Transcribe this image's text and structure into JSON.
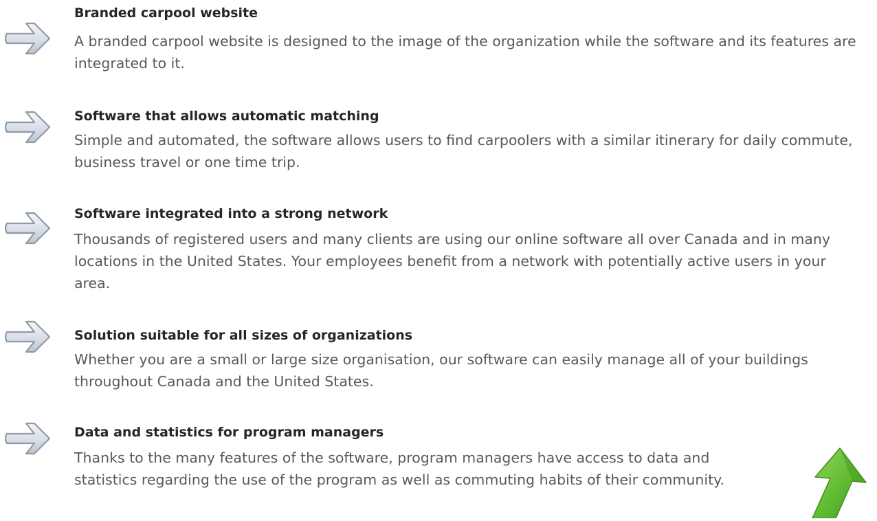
{
  "features": [
    {
      "icon": "right-arrow-icon",
      "title": "Branded carpool website",
      "description": "A branded carpool website is designed to the image of the organization while the software and its features are integrated to it."
    },
    {
      "icon": "right-arrow-icon",
      "title": "Software that allows automatic matching",
      "description": "Simple and automated, the software allows users to find carpoolers with a similar itinerary for daily commute, business travel or one time trip."
    },
    {
      "icon": "right-arrow-icon",
      "title": "Software integrated into a strong network",
      "description": "Thousands of registered users and many clients are using our online software all over Canada and in many locations in the United States. Your employees benefit from a network with potentially active users in your area."
    },
    {
      "icon": "right-arrow-icon",
      "title": "Solution suitable for all sizes of organizations",
      "description": "Whether you are a small or large size organisation, our software can easily manage all of your buildings throughout Canada and the United States."
    },
    {
      "icon": "right-arrow-icon",
      "title": "Data and statistics for program managers",
      "description": "Thanks to the many features of the software, program managers have access to data and statistics regarding the use of the program as well as commuting habits of their community."
    }
  ],
  "decoration": {
    "icon": "green-up-arrow-icon",
    "color": "#5cb82e"
  },
  "colors": {
    "title": "#262626",
    "body": "#595959",
    "arrow_fill": "#d8dee6",
    "arrow_stroke": "#8e9aa8"
  }
}
